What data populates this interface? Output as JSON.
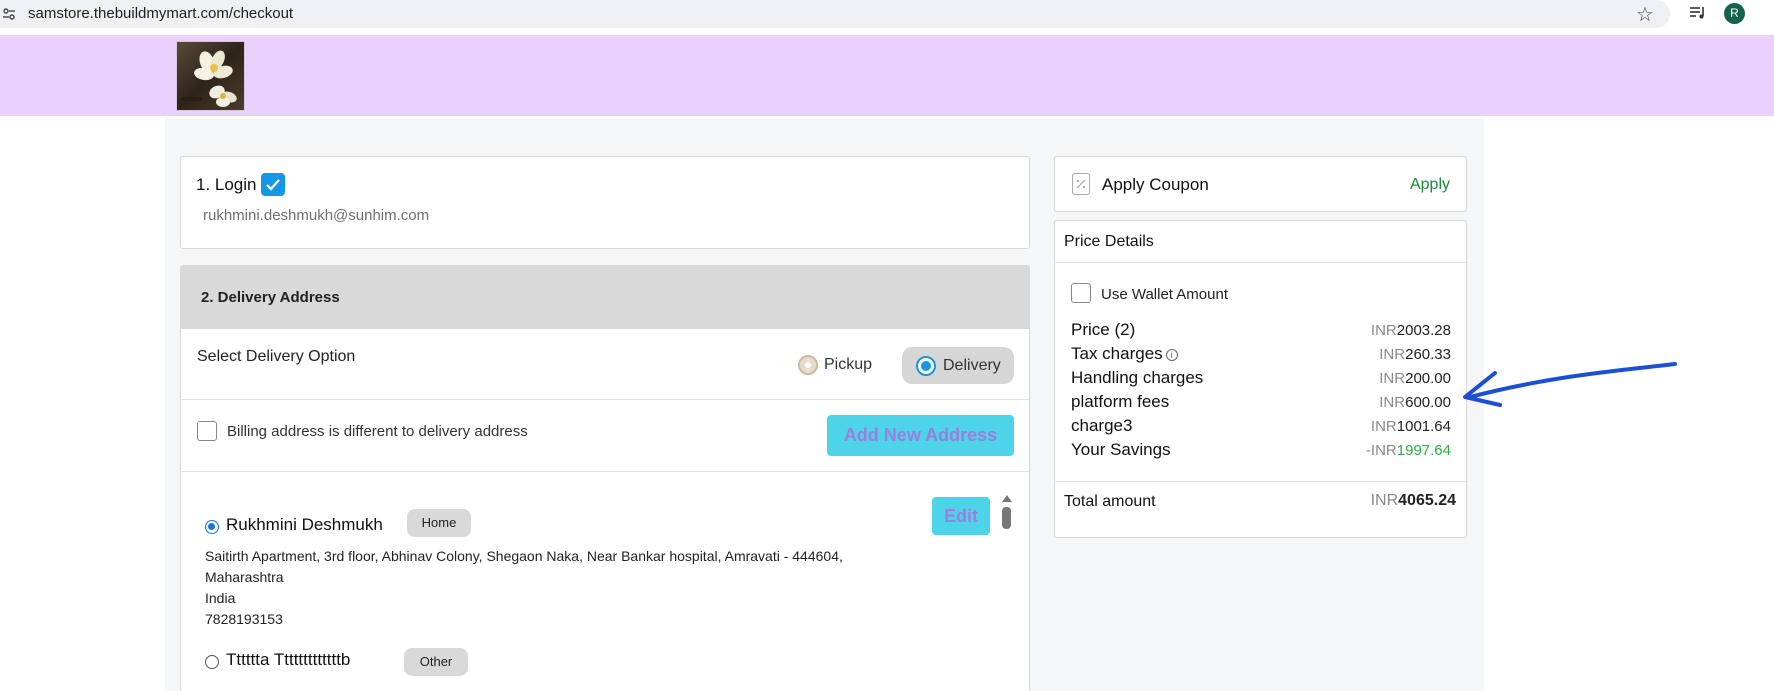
{
  "browser": {
    "url": "samstore.thebuildmymart.com/checkout",
    "avatar_letter": "R"
  },
  "login": {
    "title": "1. Login",
    "email": "rukhmini.deshmukh@sunhim.com"
  },
  "delivery": {
    "title": "2. Delivery Address",
    "option_label": "Select Delivery Option",
    "pickup_label": "Pickup",
    "delivery_label": "Delivery",
    "billing_text": "Billing address is different to delivery address",
    "add_address_label": "Add New Address",
    "edit_label": "Edit",
    "addresses": [
      {
        "name": "Rukhmini Deshmukh",
        "tag": "Home",
        "lines": [
          "Saitirth Apartment, 3rd floor, Abhinav Colony, Shegaon Naka, Near Bankar hospital, Amravati - 444604,",
          "Maharashtra",
          "India",
          "7828193153"
        ]
      },
      {
        "name": "Tttttta Tttttttttttttb",
        "tag": "Other"
      }
    ]
  },
  "coupon": {
    "label": "Apply Coupon",
    "apply": "Apply"
  },
  "price": {
    "title": "Price Details",
    "wallet_label": "Use Wallet Amount",
    "currency": "INR",
    "rows": [
      {
        "label": "Price (2)",
        "value": "2003.28"
      },
      {
        "label": "Tax charges",
        "value": "260.33"
      },
      {
        "label": "Handling charges",
        "value": "200.00"
      },
      {
        "label": "platform fees",
        "value": "600.00"
      },
      {
        "label": "charge3",
        "value": "1001.64"
      },
      {
        "label": "Your Savings",
        "prefix": "-",
        "value": "1997.64"
      }
    ],
    "total_label": "Total amount",
    "total_value": "4065.24"
  },
  "colors": {
    "header_bg": "#ebd0fc",
    "accent_blue": "#1597e5",
    "button_cyan": "#4dd4e9",
    "savings_green": "#2eab44",
    "arrow_blue": "#1a4fd6"
  }
}
